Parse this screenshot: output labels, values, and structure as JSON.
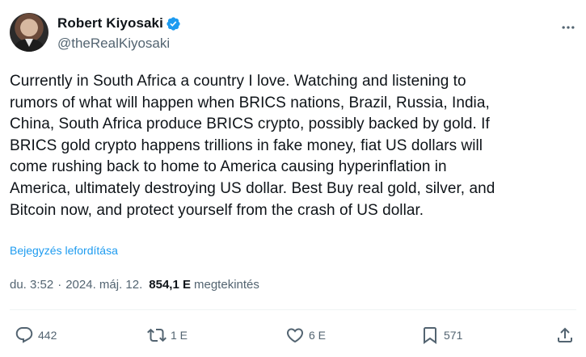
{
  "author": {
    "display_name": "Robert Kiyosaki",
    "handle": "@theRealKiyosaki",
    "verified": true,
    "verified_color": "#1d9bf0"
  },
  "tweet": {
    "text": "Currently in South Africa a country I love. Watching and listening to\nrumors of what will happen when BRICS nations, Brazil, Russia, India,\nChina, South Africa produce BRICS crypto, possibly backed by gold. If\nBRICS gold crypto happens trillions in fake money, fiat US dollars will\ncome rushing back to home to America causing hyperinflation in\nAmerica, ultimately destroying US dollar. Best Buy real gold, silver, and\nBitcoin now, and protect yourself from the crash of US dollar.",
    "translate_label": "Bejegyzés lefordítása",
    "time": "du. 3:52",
    "separator": "·",
    "date": "2024. máj. 12.",
    "views_count": "854,1 E",
    "views_label": "megtekintés"
  },
  "actions": {
    "replies": "442",
    "reposts": "1 E",
    "likes": "6 E",
    "bookmarks": "571"
  },
  "icons": {
    "more": "more-horizontal-icon",
    "reply": "reply-icon",
    "repost": "repost-icon",
    "like": "heart-icon",
    "bookmark": "bookmark-icon",
    "share": "share-icon",
    "verified": "verified-badge-icon"
  },
  "colors": {
    "accent": "#1d9bf0",
    "text_primary": "#0f1419",
    "text_secondary": "#536471"
  }
}
